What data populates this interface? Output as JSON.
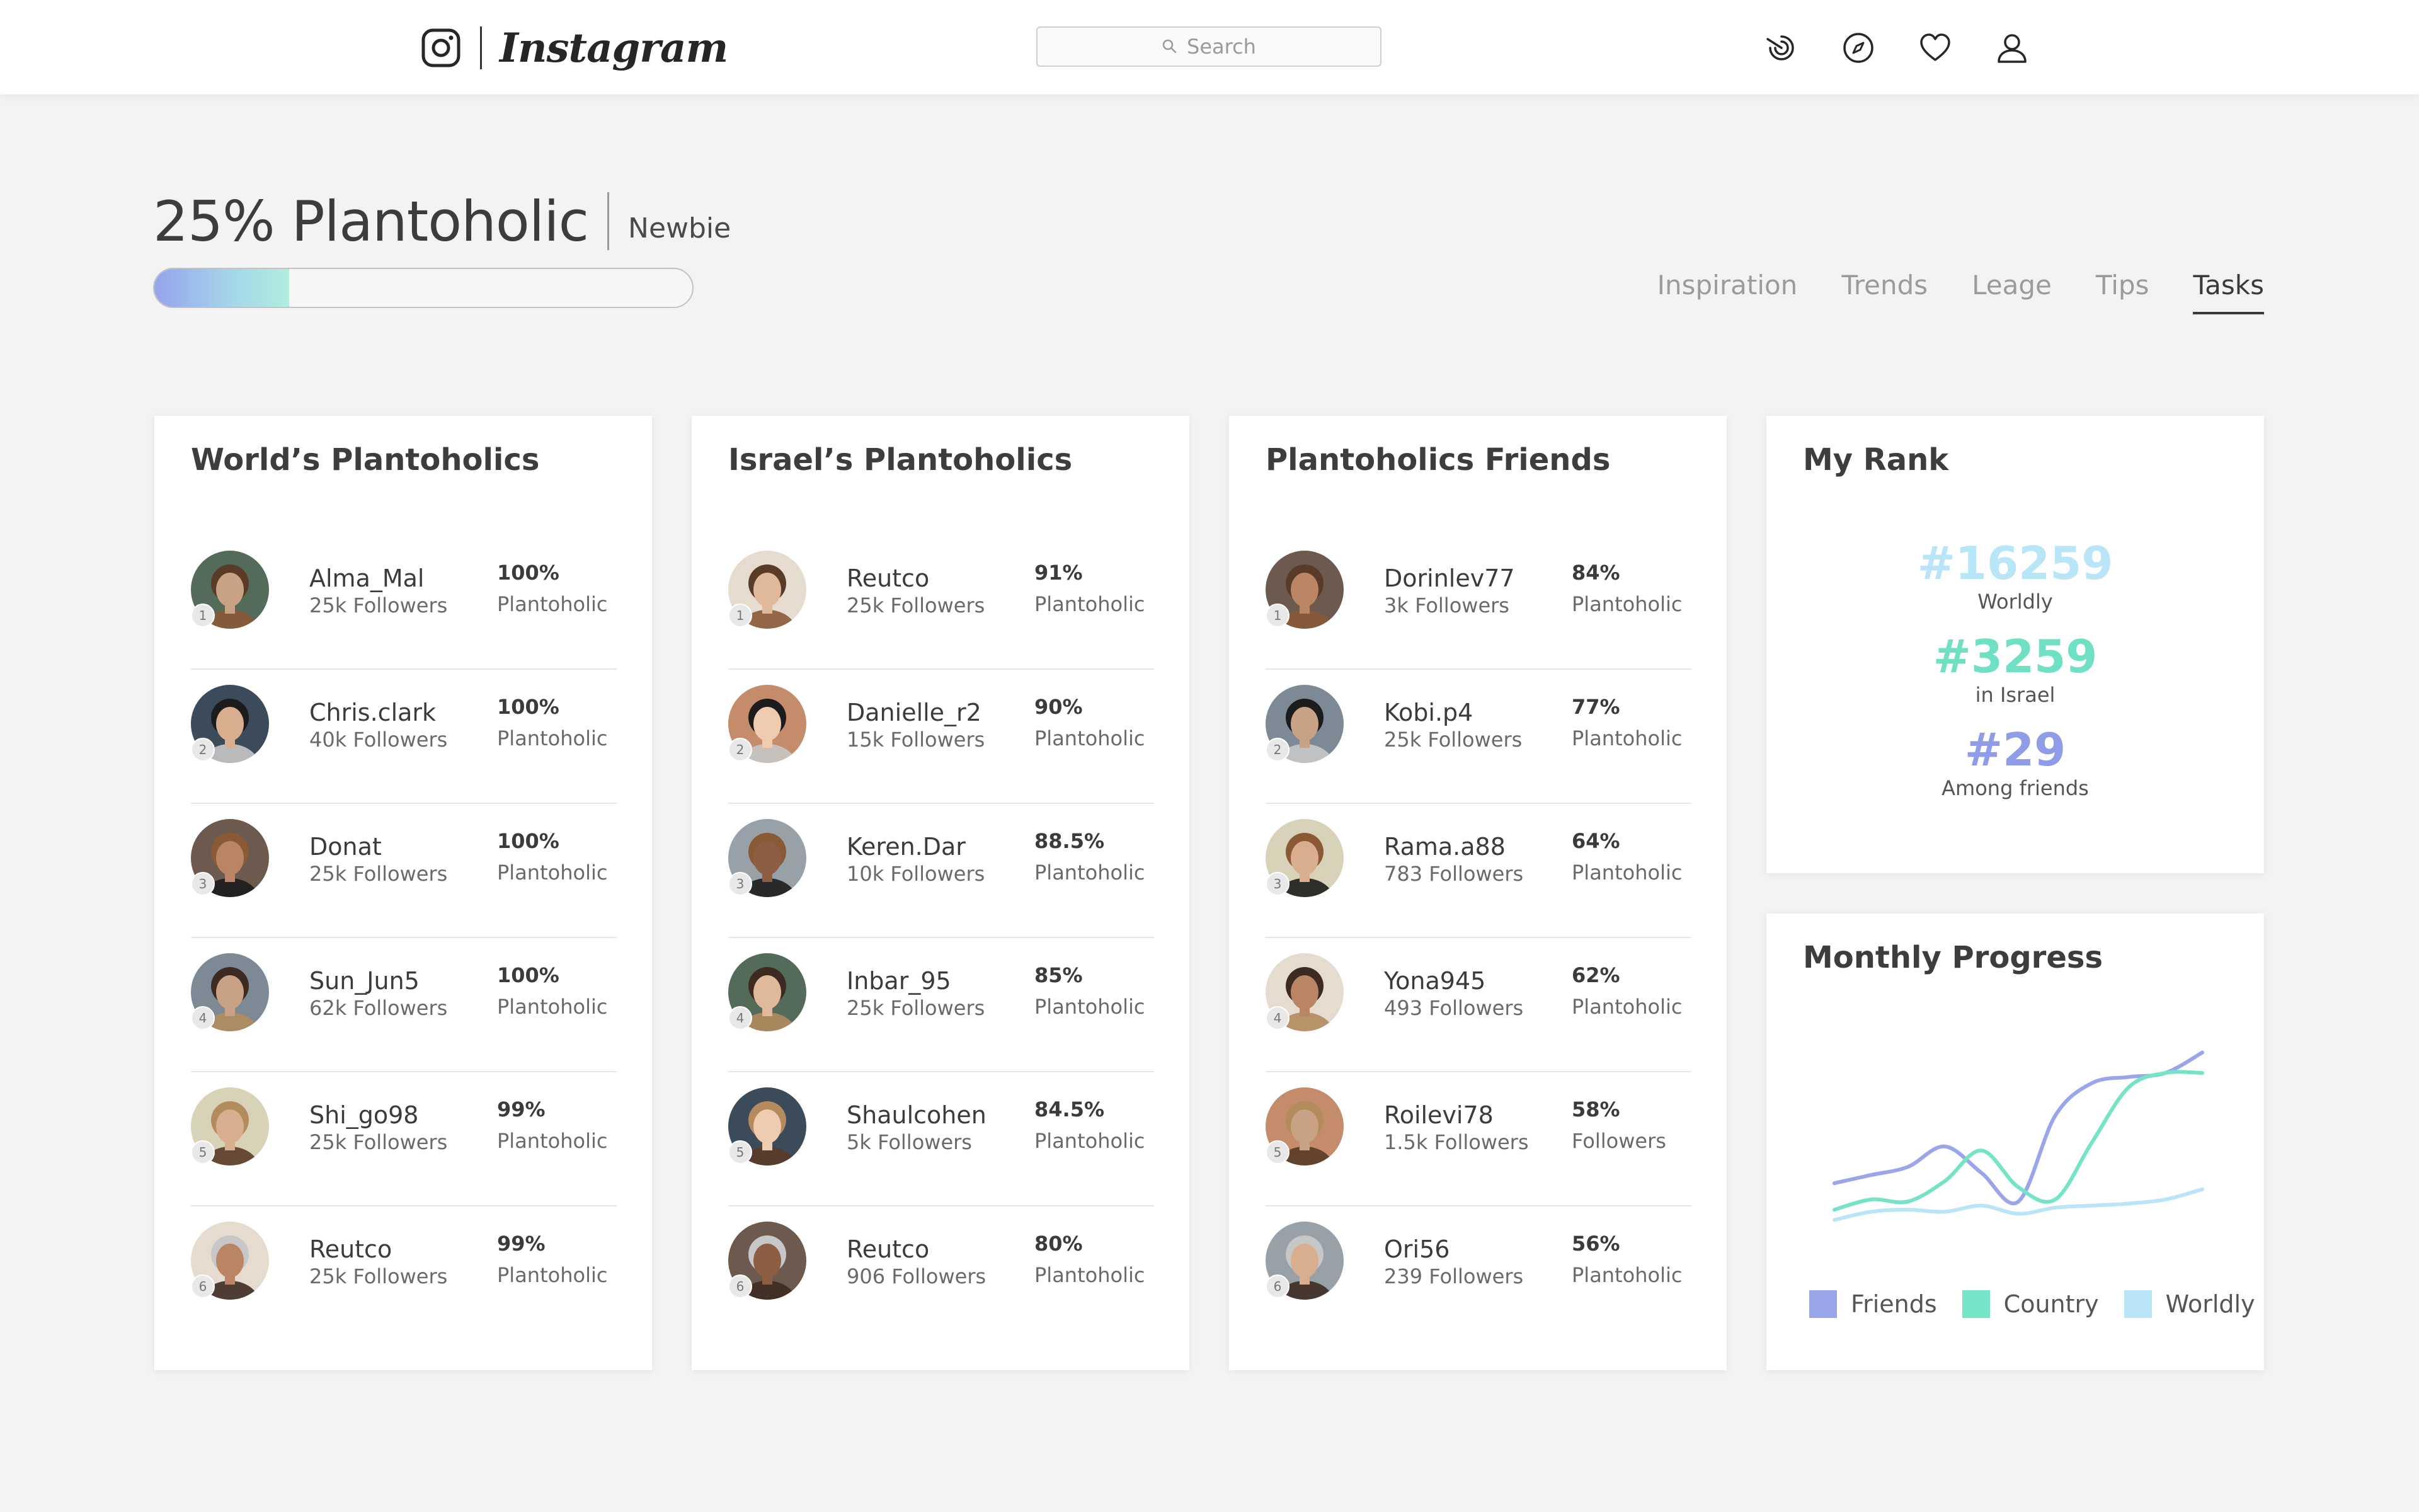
{
  "topbar": {
    "app_name": "Instagram",
    "search_placeholder": "Search",
    "icons": [
      "activity-icon",
      "compass-icon",
      "heart-icon",
      "profile-icon"
    ]
  },
  "header": {
    "level_title": "25% Plantoholic",
    "level_name": "Newbie",
    "progress": 0.25,
    "progress_colors": [
      "#97a3ec",
      "#b2ecde"
    ]
  },
  "tabs": [
    {
      "label": "Inspiration",
      "active": false
    },
    {
      "label": "Trends",
      "active": false
    },
    {
      "label": "Leage",
      "active": false
    },
    {
      "label": "Tips",
      "active": false
    },
    {
      "label": "Tasks",
      "active": true
    }
  ],
  "leaderboards": [
    {
      "title": "World’s Plantoholics",
      "rows": [
        {
          "rank": "1",
          "name": "Alma_Mal",
          "followers": "25k Followers",
          "percent": "100%",
          "label": "Plantoholic"
        },
        {
          "rank": "2",
          "name": "Chris.clark",
          "followers": "40k Followers",
          "percent": "100%",
          "label": "Plantoholic"
        },
        {
          "rank": "3",
          "name": "Donat",
          "followers": "25k Followers",
          "percent": "100%",
          "label": "Plantoholic"
        },
        {
          "rank": "4",
          "name": "Sun_Jun5",
          "followers": "62k Followers",
          "percent": "100%",
          "label": "Plantoholic"
        },
        {
          "rank": "5",
          "name": "Shi_go98",
          "followers": "25k Followers",
          "percent": "99%",
          "label": "Plantoholic"
        },
        {
          "rank": "6",
          "name": "Reutco",
          "followers": "25k Followers",
          "percent": "99%",
          "label": "Plantoholic"
        }
      ]
    },
    {
      "title": "Israel’s Plantoholics",
      "rows": [
        {
          "rank": "1",
          "name": "Reutco",
          "followers": "25k Followers",
          "percent": "91%",
          "label": "Plantoholic"
        },
        {
          "rank": "2",
          "name": "Danielle_r2",
          "followers": "15k Followers",
          "percent": "90%",
          "label": "Plantoholic"
        },
        {
          "rank": "3",
          "name": "Keren.Dar",
          "followers": "10k Followers",
          "percent": "88.5%",
          "label": "Plantoholic"
        },
        {
          "rank": "4",
          "name": "Inbar_95",
          "followers": "25k Followers",
          "percent": "85%",
          "label": "Plantoholic"
        },
        {
          "rank": "5",
          "name": "Shaulcohen",
          "followers": "5k Followers",
          "percent": "84.5%",
          "label": "Plantoholic"
        },
        {
          "rank": "6",
          "name": "Reutco",
          "followers": "906 Followers",
          "percent": "80%",
          "label": "Plantoholic"
        }
      ]
    },
    {
      "title": "Plantoholics Friends",
      "rows": [
        {
          "rank": "1",
          "name": "Dorinlev77",
          "followers": "3k Followers",
          "percent": "84%",
          "label": "Plantoholic"
        },
        {
          "rank": "2",
          "name": "Kobi.p4",
          "followers": "25k Followers",
          "percent": "77%",
          "label": "Plantoholic"
        },
        {
          "rank": "3",
          "name": "Rama.a88",
          "followers": "783 Followers",
          "percent": "64%",
          "label": "Plantoholic"
        },
        {
          "rank": "4",
          "name": "Yona945",
          "followers": "493 Followers",
          "percent": "62%",
          "label": "Plantoholic"
        },
        {
          "rank": "5",
          "name": "Roilevi78",
          "followers": "1.5k Followers",
          "percent": "58%",
          "label": "Followers"
        },
        {
          "rank": "6",
          "name": "Ori56",
          "followers": "239 Followers",
          "percent": "56%",
          "label": "Plantoholic"
        }
      ]
    }
  ],
  "my_rank": {
    "title": "My Rank",
    "items": [
      {
        "value": "#16259",
        "label": "Worldly",
        "color": "#b8e6f8"
      },
      {
        "value": "#3259",
        "label": "in Israel",
        "color": "#6fe0c3"
      },
      {
        "value": "#29",
        "label": "Among friends",
        "color": "#8f9de8"
      }
    ]
  },
  "monthly_progress": {
    "title": "Monthly Progress",
    "chart_data": {
      "type": "line",
      "x": [
        0,
        1,
        2,
        3,
        4,
        5,
        6,
        7,
        8,
        9,
        10
      ],
      "series": [
        {
          "name": "Friends",
          "color": "#9aa5ea",
          "values": [
            0.29,
            0.33,
            0.37,
            0.47,
            0.34,
            0.2,
            0.62,
            0.78,
            0.81,
            0.83,
            0.93
          ]
        },
        {
          "name": "Country",
          "color": "#75e3c6",
          "values": [
            0.16,
            0.21,
            0.2,
            0.3,
            0.45,
            0.27,
            0.21,
            0.49,
            0.76,
            0.83,
            0.83
          ]
        },
        {
          "name": "Worldly",
          "color": "#b8e6f8",
          "values": [
            0.11,
            0.15,
            0.16,
            0.15,
            0.18,
            0.14,
            0.17,
            0.18,
            0.19,
            0.21,
            0.26
          ]
        }
      ],
      "ylim": [
        0,
        1
      ],
      "grid": false,
      "legend": "bottom"
    }
  }
}
